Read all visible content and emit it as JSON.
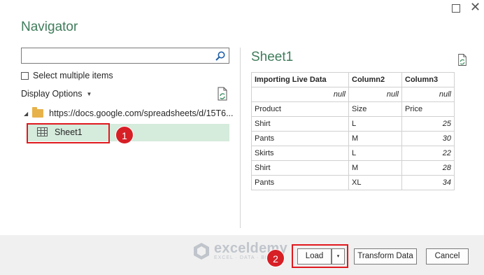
{
  "window": {
    "title": "Navigator",
    "maximize_glyph": "☐",
    "close_glyph": "✕"
  },
  "left": {
    "search_placeholder": "",
    "select_multiple_label": "Select multiple items",
    "display_options_label": "Display Options",
    "tree": {
      "source": "https://docs.google.com/spreadsheets/d/15T6...",
      "sheet": "Sheet1"
    }
  },
  "preview": {
    "title": "Sheet1",
    "columns": [
      "Importing Live Data",
      "Column2",
      "Column3"
    ],
    "rows": [
      [
        "null",
        "null",
        "null"
      ],
      [
        "Product",
        "Size",
        "Price"
      ],
      [
        "Shirt",
        "L",
        "25"
      ],
      [
        "Pants",
        "M",
        "30"
      ],
      [
        "Skirts",
        "L",
        "22"
      ],
      [
        "Shirt",
        "M",
        "28"
      ],
      [
        "Pants",
        "XL",
        "34"
      ]
    ]
  },
  "badges": {
    "one": "1",
    "two": "2"
  },
  "watermark": {
    "name": "exceldemy",
    "tagline": "EXCEL · DATA · BI"
  },
  "buttons": {
    "load": "Load",
    "load_caret": "▾",
    "transform": "Transform Data",
    "cancel": "Cancel"
  },
  "colors": {
    "accent_green": "#3f7c5b",
    "selection": "#d5ebdc",
    "highlight_red": "#e0191e"
  }
}
